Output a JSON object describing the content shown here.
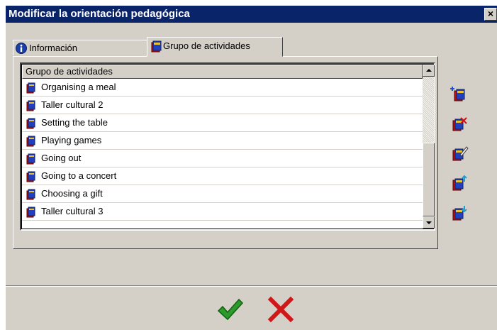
{
  "dialog": {
    "title": "Modificar la orientación pedagógica",
    "close_label": "×"
  },
  "tabs": [
    {
      "label": "Información",
      "icon": "info-icon",
      "active": false
    },
    {
      "label": "Grupo de actividades",
      "icon": "book-icon",
      "active": true
    }
  ],
  "list": {
    "header": "Grupo de actividades",
    "items": [
      "Organising a meal",
      "Taller cultural 2",
      "Setting the table",
      "Playing games",
      "Going out",
      "Going to a concert",
      "Choosing a gift",
      "Taller cultural 3"
    ]
  },
  "side_tools": [
    {
      "name": "add-group-icon"
    },
    {
      "name": "delete-group-icon"
    },
    {
      "name": "edit-group-icon"
    },
    {
      "name": "move-up-icon"
    },
    {
      "name": "move-down-icon"
    }
  ],
  "colors": {
    "titlebar": "#0a246a",
    "dialog_bg": "#d4d0c8",
    "ok": "#2a9a2a",
    "cancel": "#d01818"
  }
}
